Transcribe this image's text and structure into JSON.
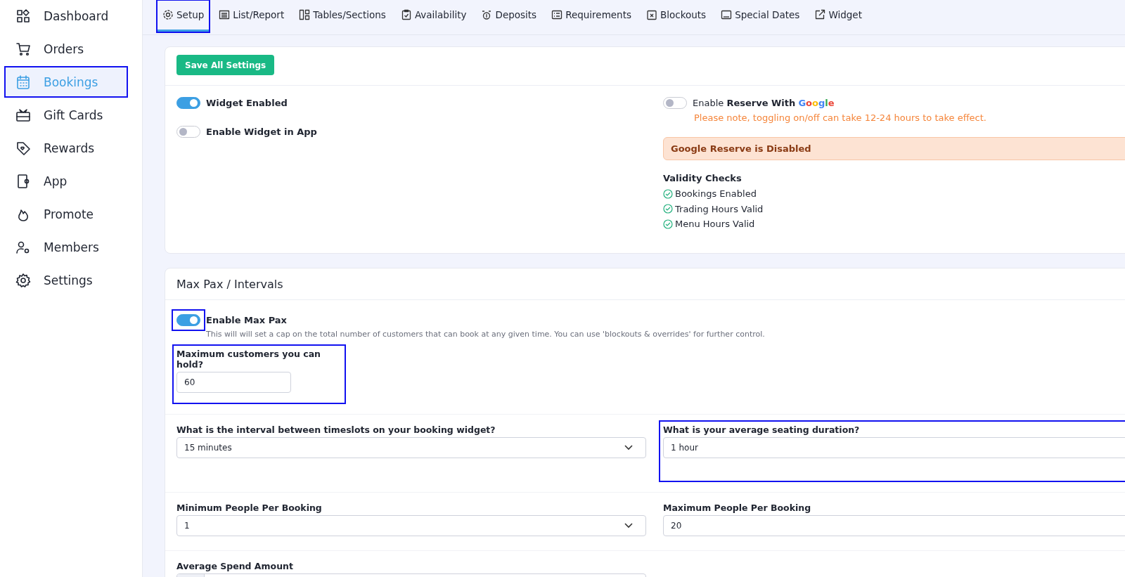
{
  "sidebar": {
    "items": [
      {
        "label": "Dashboard",
        "selected": false,
        "highlighted": false
      },
      {
        "label": "Orders",
        "selected": false,
        "highlighted": false
      },
      {
        "label": "Bookings",
        "selected": true,
        "highlighted": true
      },
      {
        "label": "Gift Cards",
        "selected": false,
        "highlighted": false
      },
      {
        "label": "Rewards",
        "selected": false,
        "highlighted": false
      },
      {
        "label": "App",
        "selected": false,
        "highlighted": false
      },
      {
        "label": "Promote",
        "selected": false,
        "highlighted": false
      },
      {
        "label": "Members",
        "selected": false,
        "highlighted": false
      },
      {
        "label": "Settings",
        "selected": false,
        "highlighted": false
      }
    ]
  },
  "tabs": [
    {
      "label": "Setup",
      "selected": true,
      "highlighted": true
    },
    {
      "label": "List/Report",
      "selected": false,
      "highlighted": false
    },
    {
      "label": "Tables/Sections",
      "selected": false,
      "highlighted": false
    },
    {
      "label": "Availability",
      "selected": false,
      "highlighted": false
    },
    {
      "label": "Deposits",
      "selected": false,
      "highlighted": false
    },
    {
      "label": "Requirements",
      "selected": false,
      "highlighted": false
    },
    {
      "label": "Blockouts",
      "selected": false,
      "highlighted": false
    },
    {
      "label": "Special Dates",
      "selected": false,
      "highlighted": false
    },
    {
      "label": "Widget",
      "selected": false,
      "highlighted": false
    }
  ],
  "setup_card": {
    "save_button": "Save All Settings",
    "toggles": [
      {
        "label": "Widget Enabled",
        "on": true
      },
      {
        "label": "Enable Widget in App",
        "on": false
      }
    ],
    "google": {
      "label": "Enable **Reserve With**",
      "brand": "Google",
      "on": false,
      "note": "Please note, toggling on/off can take 12-24 hours to take effect.",
      "alert": "Google Reserve is Disabled"
    },
    "validity": {
      "title": "Validity Checks",
      "items": [
        {
          "label": "Bookings Enabled",
          "passed": true
        },
        {
          "label": "Trading Hours Valid",
          "passed": true
        },
        {
          "label": "Menu Hours Valid",
          "passed": true
        }
      ]
    }
  },
  "max_pax_card": {
    "title": "Max Pax / Intervals",
    "toggle": {
      "label": "Enable Max Pax",
      "on": true,
      "highlighted": true,
      "description": "This will will set a cap on the total number of customers that can book at any given time. You can use 'blockouts & overrides' for further control."
    },
    "rows": [
      {
        "fields": [
          {
            "label": "Maximum customers you can hold?",
            "value": "60",
            "kind": "short",
            "highlighted": true
          }
        ]
      },
      {
        "fields": [
          {
            "label": "What is the interval between timeslots on your booking widget?",
            "value": "15 minutes",
            "kind": "select",
            "highlighted": false
          },
          {
            "label": "What is your average seating duration?",
            "value": "1 hour",
            "kind": "input",
            "highlighted": true
          }
        ]
      },
      {
        "fields": [
          {
            "label": "Minimum People Per Booking",
            "value": "1",
            "kind": "select",
            "highlighted": false
          },
          {
            "label": "Maximum People Per Booking",
            "value": "20",
            "kind": "input",
            "highlighted": false
          }
        ]
      },
      {
        "fields": [
          {
            "label": "Average Spend Amount",
            "kind": "currency",
            "highlighted": false
          }
        ]
      }
    ]
  }
}
